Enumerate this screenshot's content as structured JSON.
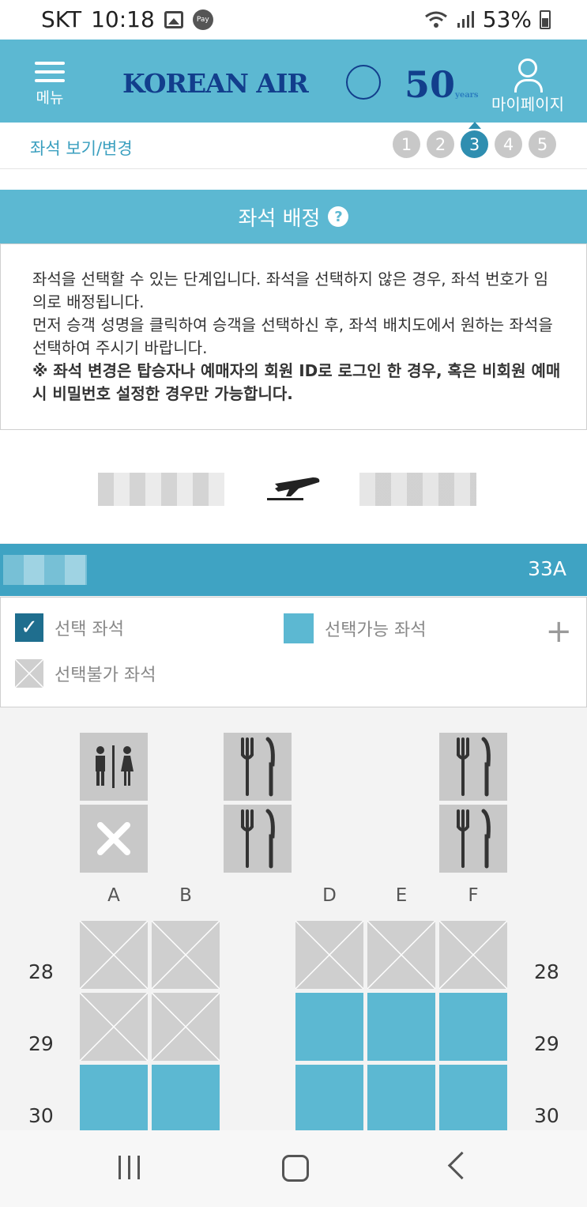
{
  "status_bar": {
    "carrier": "SKT",
    "time": "10:18",
    "pay_badge": "Pay",
    "battery": "53%"
  },
  "header": {
    "menu_label": "메뉴",
    "logo_text": "KOREAN AIR",
    "anniversary": "50",
    "anniversary_sub": "years",
    "mypage_label": "마이페이지"
  },
  "steps_bar": {
    "title": "좌석 보기/변경",
    "steps": [
      "1",
      "2",
      "3",
      "4",
      "5"
    ],
    "active_step": "3"
  },
  "seat_assignment": {
    "title": "좌석 배정",
    "help_icon": "?",
    "info_line1": "좌석을 선택할 수 있는 단계입니다. 좌석을 선택하지 않은 경우, 좌석 번호가 임의로 배정됩니다.",
    "info_line2": "먼저 승객 성명을 클릭하여 승객을 선택하신 후, 좌석 배치도에서 원하는 좌석을 선택하여 주시기 바랍니다.",
    "info_line3": "※ 좌석 변경은 탑승자나 예매자의 회원 ID로 로그인 한 경우, 혹은 비회원 예매 시 비밀번호 설정한 경우만 가능합니다."
  },
  "passenger": {
    "seat": "33A"
  },
  "legend": {
    "selected": "선택 좌석",
    "available": "선택가능 좌석",
    "unavailable": "선택불가 좌석",
    "expand": "+"
  },
  "seat_map": {
    "columns": [
      "A",
      "B",
      "D",
      "E",
      "F"
    ],
    "rows": [
      "28",
      "29",
      "30"
    ]
  },
  "colors": {
    "header": "#5cb8d2",
    "passenger_bar": "#3fa3c3",
    "available": "#5cb8d2",
    "unavailable": "#cfcfcf",
    "selected": "#1f6e8e"
  }
}
